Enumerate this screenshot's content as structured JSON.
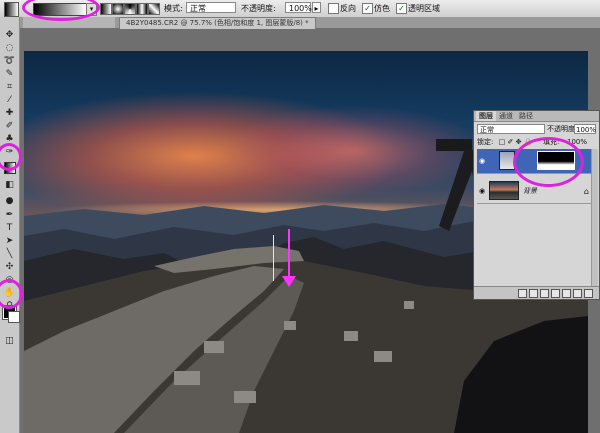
{
  "options_bar": {
    "mode_label": "模式:",
    "mode_value": "正常",
    "opacity_label": "不透明度:",
    "opacity_value": "100%",
    "reverse_label": "反向",
    "dither_label": "仿色",
    "transparency_label": "透明区域"
  },
  "document_tab": {
    "title": "4B2Y0485.CR2 @ 75.7% (色相/饱和度 1, 图层蒙版/8) *"
  },
  "layers_panel": {
    "tabs": [
      "图层",
      "通道",
      "路径"
    ],
    "blend_mode": "正常",
    "opacity_label": "不透明度:",
    "opacity_value": "100%",
    "lock_label": "锁定:",
    "fill_label": "填充:",
    "fill_value": "100%",
    "layers": [
      {
        "name": "",
        "selected": true,
        "type": "adjustment-with-mask"
      },
      {
        "name": "背景",
        "selected": false,
        "type": "background"
      }
    ]
  },
  "colors": {
    "highlight": "#dd22dd",
    "selected_layer": "#3f65b7",
    "foreground": "#000000",
    "background": "#ffffff"
  }
}
